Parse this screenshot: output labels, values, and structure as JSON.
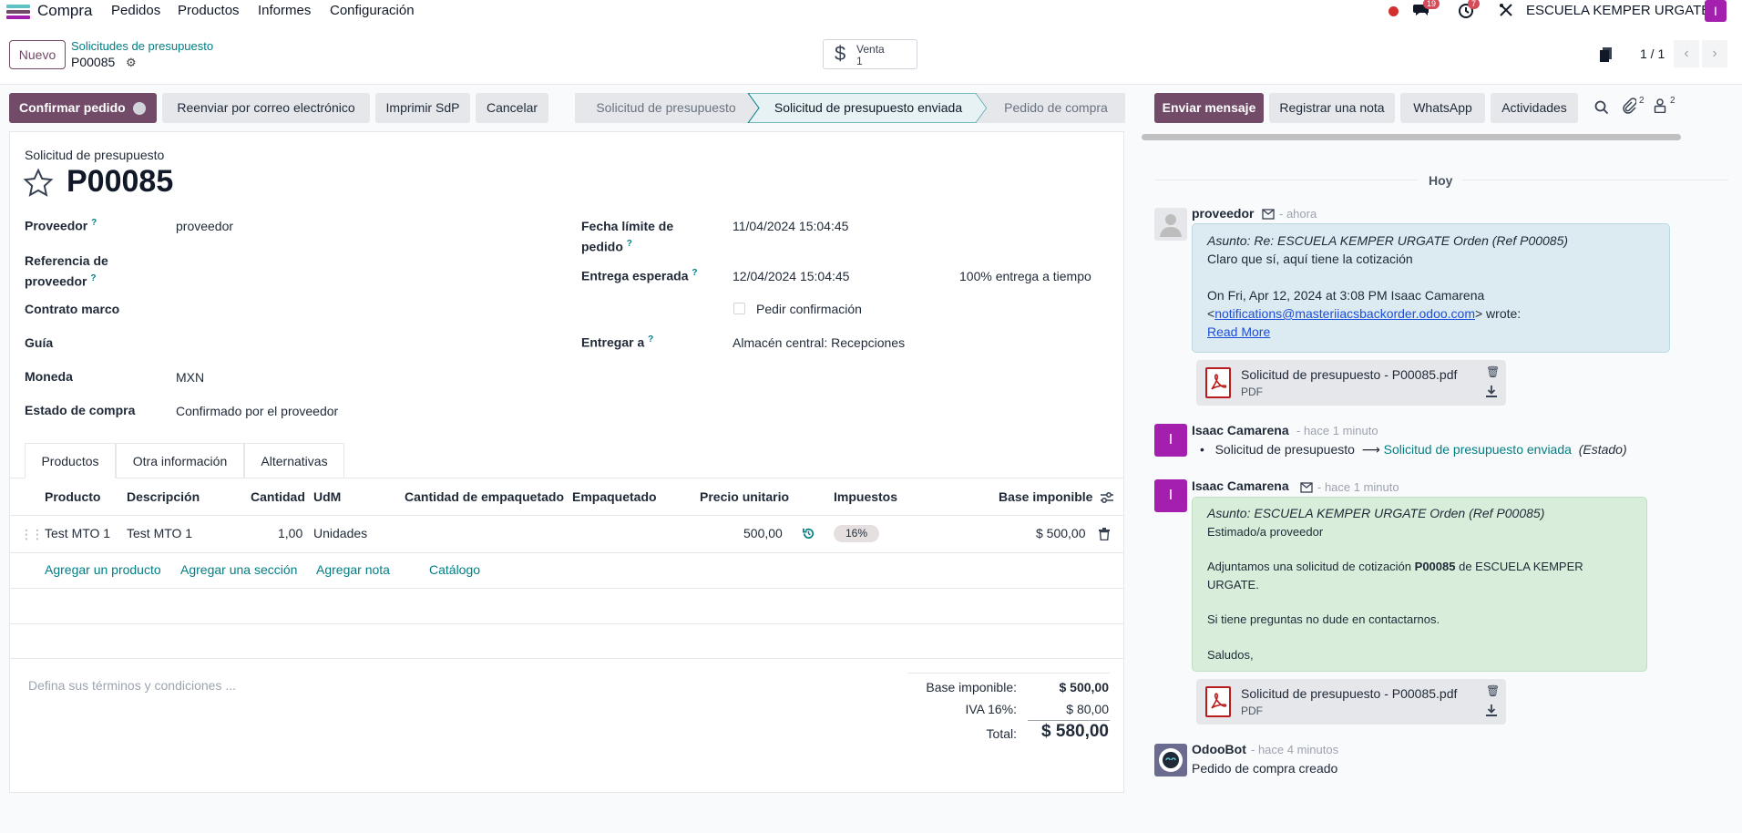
{
  "app": {
    "name": "Compra"
  },
  "nav": {
    "menu": [
      "Pedidos",
      "Productos",
      "Informes",
      "Configuración"
    ],
    "messages_count": "19",
    "activities_count": "7",
    "company": "ESCUELA KEMPER URGATE",
    "user_initial": "I"
  },
  "control": {
    "new_label": "Nuevo",
    "breadcrumb": "Solicitudes de presupuesto",
    "record": "P00085",
    "smart_label": "Venta",
    "smart_value": "1",
    "pager": "1 / 1"
  },
  "actions": {
    "confirm": "Confirmar pedido",
    "resend": "Reenviar por correo electrónico",
    "print": "Imprimir SdP",
    "cancel": "Cancelar"
  },
  "status": {
    "steps": [
      "Solicitud de presupuesto",
      "Solicitud de presupuesto enviada",
      "Pedido de compra"
    ],
    "current": 1
  },
  "form": {
    "doc_type": "Solicitud de presupuesto",
    "name": "P00085",
    "fields_left": [
      {
        "label": "Proveedor",
        "help": "?",
        "value": "proveedor"
      },
      {
        "label": "Referencia de proveedor",
        "help": "?",
        "value": ""
      },
      {
        "label": "Contrato marco",
        "value": ""
      },
      {
        "label": "Guía",
        "value": ""
      },
      {
        "label": "Moneda",
        "value": "MXN"
      },
      {
        "label": "Estado de compra",
        "value": "Confirmado por el proveedor"
      }
    ],
    "deadline_label": "Fecha límite de pedido",
    "deadline_value": "11/04/2024 15:04:45",
    "expected_label": "Entrega esperada",
    "expected_value": "12/04/2024 15:04:45",
    "on_time": "100% entrega a tiempo",
    "ask_confirm": "Pedir confirmación",
    "deliver_label": "Entregar a",
    "deliver_value": "Almacén central: Recepciones",
    "help_mark": "?"
  },
  "tabs": [
    "Productos",
    "Otra información",
    "Alternativas"
  ],
  "lines": {
    "headers": [
      "Producto",
      "Descripción",
      "Cantidad",
      "UdM",
      "Cantidad de empaquetado",
      "Empaquetado",
      "Precio unitario",
      "Impuestos",
      "Base imponible"
    ],
    "rows": [
      {
        "product": "Test MTO 1",
        "description": "Test MTO 1",
        "qty": "1,00",
        "uom": "Unidades",
        "pkg_qty": "",
        "pkg": "",
        "price": "500,00",
        "tax": "16%",
        "subtotal": "$ 500,00"
      }
    ],
    "add_product": "Agregar un producto",
    "add_section": "Agregar una sección",
    "add_note": "Agregar nota",
    "catalog": "Catálogo"
  },
  "terms_placeholder": "Defina sus términos y condiciones ...",
  "totals": {
    "base_label": "Base imponible:",
    "base_value": "$ 500,00",
    "iva_label": "IVA 16%:",
    "iva_value": "$ 80,00",
    "total_label": "Total:",
    "total_value": "$ 580,00"
  },
  "chatter": {
    "send_message": "Enviar mensaje",
    "log_note": "Registrar una nota",
    "whatsapp": "WhatsApp",
    "activities": "Actividades",
    "attachments_count": "2",
    "followers_count": "2",
    "today": "Hoy",
    "messages": [
      {
        "author": "proveedor",
        "time": "- ahora",
        "subject": "Asunto: Re: ESCUELA KEMPER URGATE Orden (Ref P00085)",
        "line1": "Claro que sí, aquí tiene la cotización",
        "line2": "On Fri, Apr 12, 2024 at 3:08 PM Isaac Camarena",
        "line3_pre": "<",
        "email": "notifications@masteriiacsbackorder.odoo.com",
        "line3_post": "> wrote:",
        "read_more": "Read More",
        "attachment": "Solicitud de presupuesto - P00085.pdf",
        "attachment_type": "PDF"
      },
      {
        "author": "Isaac Camarena",
        "time": "- hace 1 minuto",
        "tracking_old": "Solicitud de presupuesto",
        "tracking_new": "Solicitud de presupuesto enviada",
        "tracking_field": "(Estado)",
        "initial": "I"
      },
      {
        "author": "Isaac Camarena",
        "time": "- hace 1 minuto",
        "subject": "Asunto: ESCUELA KEMPER URGATE Orden (Ref P00085)",
        "greeting": "Estimado/a proveedor",
        "body_pre": "Adjuntamos una solicitud de cotización",
        "body_ref": "P00085",
        "body_post": "de ESCUELA KEMPER URGATE.",
        "questions": "Si tiene preguntas no dude en contactarnos.",
        "signoff": "Saludos,",
        "attachment": "Solicitud de presupuesto - P00085.pdf",
        "attachment_type": "PDF",
        "initial": "I"
      },
      {
        "author": "OdooBot",
        "time": "- hace 4 minutos",
        "body": "Pedido de compra creado"
      }
    ]
  },
  "colors": {
    "brand": "#714b67",
    "link": "#017e84",
    "avatar": "#a41fae"
  }
}
